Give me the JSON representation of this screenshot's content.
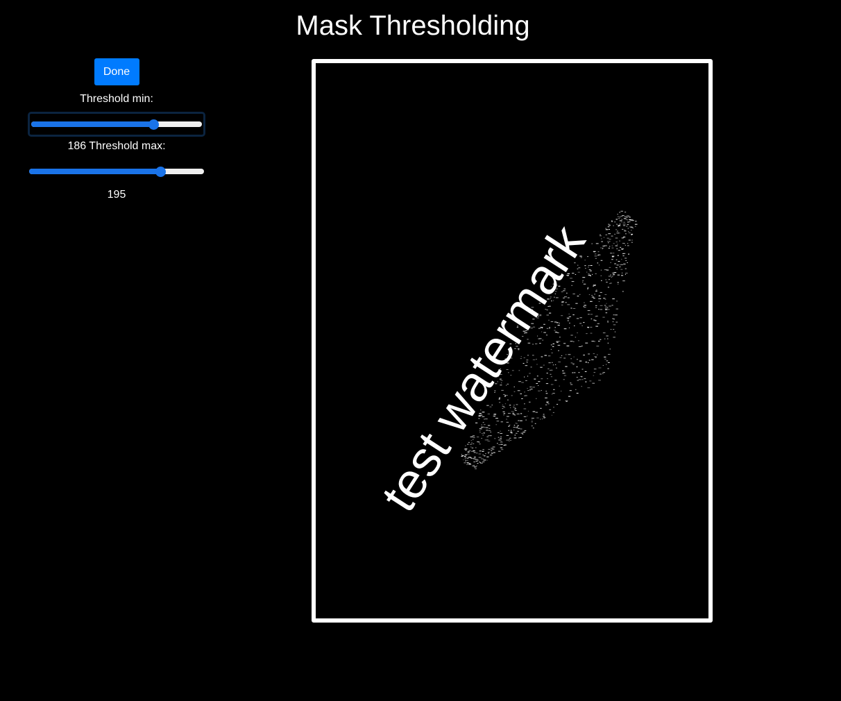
{
  "page": {
    "title": "Mask Thresholding"
  },
  "controls": {
    "done_label": "Done",
    "threshold_min_label": "Threshold min:",
    "threshold_min_value": "186",
    "threshold_max_label": "Threshold max:",
    "threshold_max_value": "195",
    "slider_min": 0,
    "slider_max": 255,
    "accent_color": "#1a73e8",
    "button_color": "#007bff"
  },
  "preview": {
    "watermark_text": "test watermark"
  }
}
